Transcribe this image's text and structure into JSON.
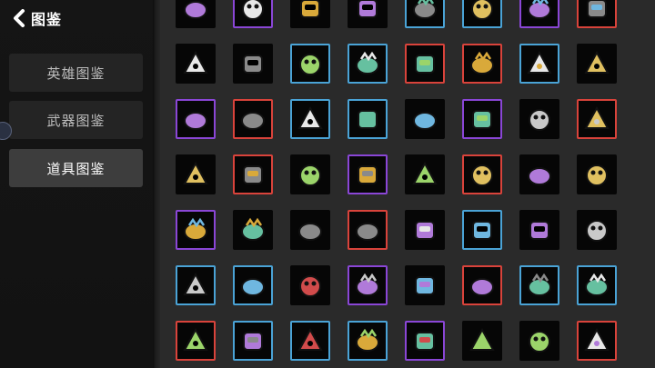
{
  "header": {
    "title": "图鉴"
  },
  "nav": [
    {
      "label": "英雄图鉴",
      "active": false
    },
    {
      "label": "武器图鉴",
      "active": false
    },
    {
      "label": "道具图鉴",
      "active": true
    }
  ],
  "rarity_colors": {
    "none": "#060606",
    "blue": "#4aa3d6",
    "purple": "#8a46d6",
    "red": "#d9433b"
  },
  "items": [
    {
      "icon": "money-bundle-icon",
      "rarity": "none"
    },
    {
      "icon": "gold-crown-icon",
      "rarity": "purple"
    },
    {
      "icon": "spider-icon",
      "rarity": "none"
    },
    {
      "icon": "knight-helmet-icon",
      "rarity": "none"
    },
    {
      "icon": "worm-icon",
      "rarity": "blue"
    },
    {
      "icon": "rabbit-icon",
      "rarity": "blue"
    },
    {
      "icon": "syringe-icon",
      "rarity": "purple"
    },
    {
      "icon": "scroll-icon",
      "rarity": "red"
    },
    {
      "icon": "wave-curl-icon",
      "rarity": "none"
    },
    {
      "icon": "dynamite-icon",
      "rarity": "none"
    },
    {
      "icon": "ring-band-icon",
      "rarity": "blue"
    },
    {
      "icon": "treasure-chest-icon",
      "rarity": "blue"
    },
    {
      "icon": "robot-walker-icon",
      "rarity": "red"
    },
    {
      "icon": "firework-icon",
      "rarity": "red"
    },
    {
      "icon": "twin-bombs-icon",
      "rarity": "blue"
    },
    {
      "icon": "green-sack-icon",
      "rarity": "none"
    },
    {
      "icon": "shark-fin-icon",
      "rarity": "purple"
    },
    {
      "icon": "axolotl-icon",
      "rarity": "red"
    },
    {
      "icon": "potion-bottle-icon",
      "rarity": "blue"
    },
    {
      "icon": "red-disc-icon",
      "rarity": "blue"
    },
    {
      "icon": "scythe-sack-icon",
      "rarity": "none"
    },
    {
      "icon": "cannon-icon",
      "rarity": "purple"
    },
    {
      "icon": "glowing-eyes-icon",
      "rarity": "none"
    },
    {
      "icon": "gnome-icon",
      "rarity": "red"
    },
    {
      "icon": "animal-skull-icon",
      "rarity": "none"
    },
    {
      "icon": "rainbow-leaf-icon",
      "rarity": "red"
    },
    {
      "icon": "running-dog-icon",
      "rarity": "none"
    },
    {
      "icon": "chain-links-icon",
      "rarity": "purple"
    },
    {
      "icon": "mummy-head-icon",
      "rarity": "none"
    },
    {
      "icon": "bullet-icon",
      "rarity": "red"
    },
    {
      "icon": "hedgehog-icon",
      "rarity": "none"
    },
    {
      "icon": "iron-helmet-icon",
      "rarity": "none"
    },
    {
      "icon": "bat-demon-icon",
      "rarity": "purple"
    },
    {
      "icon": "red-syringe-icon",
      "rarity": "none"
    },
    {
      "icon": "panda-mask-icon",
      "rarity": "none"
    },
    {
      "icon": "rocket-pair-icon",
      "rarity": "red"
    },
    {
      "icon": "bomb-stack-icon",
      "rarity": "none"
    },
    {
      "icon": "ragged-cloak-icon",
      "rarity": "blue"
    },
    {
      "icon": "honey-jar-icon",
      "rarity": "none"
    },
    {
      "icon": "slime-blob-icon",
      "rarity": "none"
    },
    {
      "icon": "frog-icon",
      "rarity": "blue"
    },
    {
      "icon": "centipede-icon",
      "rarity": "blue"
    },
    {
      "icon": "rubber-duck-icon",
      "rarity": "none"
    },
    {
      "icon": "panda-cat-icon",
      "rarity": "purple"
    },
    {
      "icon": "plaid-shirt-icon",
      "rarity": "none"
    },
    {
      "icon": "mammoth-icon",
      "rarity": "red"
    },
    {
      "icon": "ninja-mask-icon",
      "rarity": "blue"
    },
    {
      "icon": "gold-necklace-icon",
      "rarity": "blue"
    },
    {
      "icon": "first-aid-kit-icon",
      "rarity": "red"
    },
    {
      "icon": "dumbbell-icon",
      "rarity": "blue"
    },
    {
      "icon": "banana-blade-icon",
      "rarity": "blue"
    },
    {
      "icon": "drill-icon",
      "rarity": "blue"
    },
    {
      "icon": "white-rat-icon",
      "rarity": "purple"
    },
    {
      "icon": "mushroom-icon",
      "rarity": "none"
    },
    {
      "icon": "ghost-chick-icon",
      "rarity": "none"
    },
    {
      "icon": "binoculars-icon",
      "rarity": "red"
    }
  ]
}
